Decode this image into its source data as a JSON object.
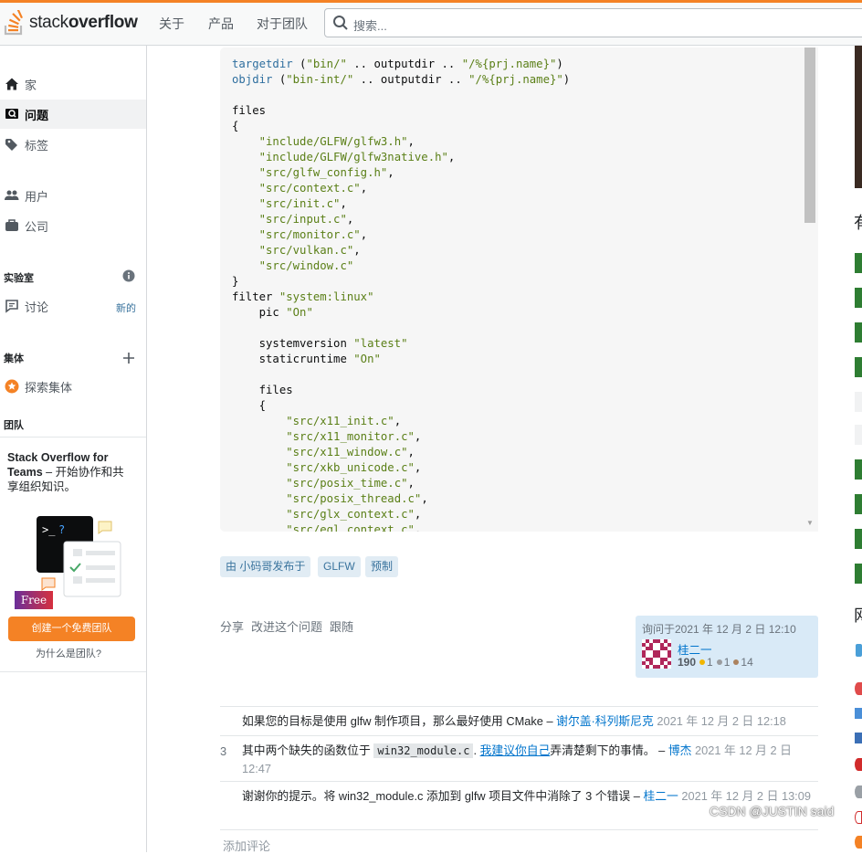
{
  "header": {
    "logo_text_light": "stack",
    "logo_text_bold": "overflow",
    "nav": [
      "关于",
      "产品",
      "对于团队"
    ],
    "search_placeholder": "搜索..."
  },
  "sidebar": {
    "items": [
      {
        "label": "家",
        "icon": "home-icon"
      },
      {
        "label": "问题",
        "icon": "questions-icon"
      },
      {
        "label": "标签",
        "icon": "tag-icon"
      },
      {
        "label": "用户",
        "icon": "users-icon"
      },
      {
        "label": "公司",
        "icon": "briefcase-icon"
      }
    ],
    "labs_title": "实验室",
    "discussion_label": "讨论",
    "discussion_badge": "新的",
    "collectives_title": "集体",
    "explore_collectives": "探索集体",
    "teams_title": "团队",
    "teams_bold": "Stack Overflow for Teams",
    "teams_text": " – 开始协作和共享组织知识。",
    "free_badge": "Free",
    "create_team_button": "创建一个免费团队",
    "why_teams": "为什么是团队?"
  },
  "code_lines": [
    [
      {
        "t": "targetdir",
        "c": "k"
      },
      {
        "t": " (",
        "c": ""
      },
      {
        "t": "\"bin/\"",
        "c": "s"
      },
      {
        "t": " .. outputdir .. ",
        "c": ""
      },
      {
        "t": "\"/%{prj.name}\"",
        "c": "s"
      },
      {
        "t": ")",
        "c": ""
      }
    ],
    [
      {
        "t": "objdir",
        "c": "k"
      },
      {
        "t": " (",
        "c": ""
      },
      {
        "t": "\"bin-int/\"",
        "c": "s"
      },
      {
        "t": " .. outputdir .. ",
        "c": ""
      },
      {
        "t": "\"/%{prj.name}\"",
        "c": "s"
      },
      {
        "t": ")",
        "c": ""
      }
    ],
    [
      {
        "t": "",
        "c": ""
      }
    ],
    [
      {
        "t": "files",
        "c": ""
      }
    ],
    [
      {
        "t": "{",
        "c": ""
      }
    ],
    [
      {
        "t": "    ",
        "c": ""
      },
      {
        "t": "\"include/GLFW/glfw3.h\"",
        "c": "s"
      },
      {
        "t": ",",
        "c": ""
      }
    ],
    [
      {
        "t": "    ",
        "c": ""
      },
      {
        "t": "\"include/GLFW/glfw3native.h\"",
        "c": "s"
      },
      {
        "t": ",",
        "c": ""
      }
    ],
    [
      {
        "t": "    ",
        "c": ""
      },
      {
        "t": "\"src/glfw_config.h\"",
        "c": "s"
      },
      {
        "t": ",",
        "c": ""
      }
    ],
    [
      {
        "t": "    ",
        "c": ""
      },
      {
        "t": "\"src/context.c\"",
        "c": "s"
      },
      {
        "t": ",",
        "c": ""
      }
    ],
    [
      {
        "t": "    ",
        "c": ""
      },
      {
        "t": "\"src/init.c\"",
        "c": "s"
      },
      {
        "t": ",",
        "c": ""
      }
    ],
    [
      {
        "t": "    ",
        "c": ""
      },
      {
        "t": "\"src/input.c\"",
        "c": "s"
      },
      {
        "t": ",",
        "c": ""
      }
    ],
    [
      {
        "t": "    ",
        "c": ""
      },
      {
        "t": "\"src/monitor.c\"",
        "c": "s"
      },
      {
        "t": ",",
        "c": ""
      }
    ],
    [
      {
        "t": "    ",
        "c": ""
      },
      {
        "t": "\"src/vulkan.c\"",
        "c": "s"
      },
      {
        "t": ",",
        "c": ""
      }
    ],
    [
      {
        "t": "    ",
        "c": ""
      },
      {
        "t": "\"src/window.c\"",
        "c": "s"
      }
    ],
    [
      {
        "t": "}",
        "c": ""
      }
    ],
    [
      {
        "t": "filter ",
        "c": ""
      },
      {
        "t": "\"system:linux\"",
        "c": "s"
      }
    ],
    [
      {
        "t": "    pic ",
        "c": ""
      },
      {
        "t": "\"On\"",
        "c": "s"
      }
    ],
    [
      {
        "t": "",
        "c": ""
      }
    ],
    [
      {
        "t": "    systemversion ",
        "c": ""
      },
      {
        "t": "\"latest\"",
        "c": "s"
      }
    ],
    [
      {
        "t": "    staticruntime ",
        "c": ""
      },
      {
        "t": "\"On\"",
        "c": "s"
      }
    ],
    [
      {
        "t": "",
        "c": ""
      }
    ],
    [
      {
        "t": "    files",
        "c": ""
      }
    ],
    [
      {
        "t": "    {",
        "c": ""
      }
    ],
    [
      {
        "t": "        ",
        "c": ""
      },
      {
        "t": "\"src/x11_init.c\"",
        "c": "s"
      },
      {
        "t": ",",
        "c": ""
      }
    ],
    [
      {
        "t": "        ",
        "c": ""
      },
      {
        "t": "\"src/x11_monitor.c\"",
        "c": "s"
      },
      {
        "t": ",",
        "c": ""
      }
    ],
    [
      {
        "t": "        ",
        "c": ""
      },
      {
        "t": "\"src/x11_window.c\"",
        "c": "s"
      },
      {
        "t": ",",
        "c": ""
      }
    ],
    [
      {
        "t": "        ",
        "c": ""
      },
      {
        "t": "\"src/xkb_unicode.c\"",
        "c": "s"
      },
      {
        "t": ",",
        "c": ""
      }
    ],
    [
      {
        "t": "        ",
        "c": ""
      },
      {
        "t": "\"src/posix_time.c\"",
        "c": "s"
      },
      {
        "t": ",",
        "c": ""
      }
    ],
    [
      {
        "t": "        ",
        "c": ""
      },
      {
        "t": "\"src/posix_thread.c\"",
        "c": "s"
      },
      {
        "t": ",",
        "c": ""
      }
    ],
    [
      {
        "t": "        ",
        "c": ""
      },
      {
        "t": "\"src/glx_context.c\"",
        "c": "s"
      },
      {
        "t": ",",
        "c": ""
      }
    ],
    [
      {
        "t": "        ",
        "c": ""
      },
      {
        "t": "\"src/egl_context.c\"",
        "c": "s"
      },
      {
        "t": ",",
        "c": ""
      }
    ]
  ],
  "tags": [
    "由 小码哥发布于",
    "GLFW",
    "预制"
  ],
  "post_menu": {
    "share": "分享",
    "improve": "改进这个问题",
    "follow": "跟随"
  },
  "asker": {
    "asked": "询问于2021 年 12 月 2 日 12:10",
    "name": "桂二一",
    "reputation": "190",
    "gold": "1",
    "silver": "1",
    "bronze": "14"
  },
  "comments": [
    {
      "score": "",
      "text": "如果您的目标是使用 glfw 制作项目，那么最好使用 CMake –",
      "user": "谢尔盖·科列斯尼克",
      "date": "2021 年 12 月 2 日 12:18"
    },
    {
      "score": "3",
      "pre": "其中两个缺失的函数位于",
      "code": "win32_module.c",
      "mid": ".",
      "link": "我建议你自己",
      "post": "弄清楚剩下的事情。 –",
      "user": "博杰",
      "date": "2021 年 12 月 2 日 12:47"
    },
    {
      "score": "",
      "text": "谢谢你的提示。将 win32_module.c 添加到 glfw 项目文件中消除了 3 个错误 –",
      "user": "桂二一",
      "date": "2021 年 12 月 2 日 13:09"
    }
  ],
  "add_comment": "添加评论",
  "watermark": "CSDN @JUSTIN said"
}
